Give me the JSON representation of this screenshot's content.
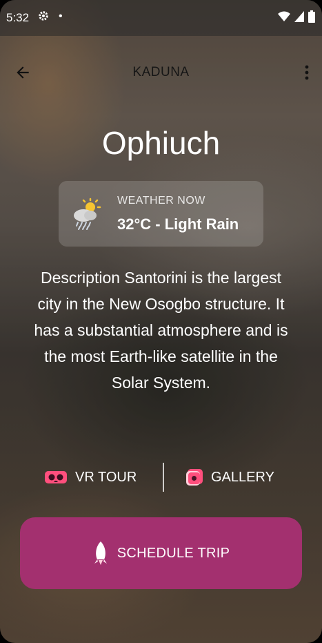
{
  "status_bar": {
    "time": "5:32",
    "icons": [
      "gear-icon",
      "dot-icon",
      "wifi-icon",
      "signal-icon",
      "battery-icon"
    ]
  },
  "app_bar": {
    "title": "KADUNA",
    "back_icon": "arrow-left-icon",
    "more_icon": "more-vert-icon"
  },
  "place": {
    "name": "Ophiuch"
  },
  "weather": {
    "label": "WEATHER NOW",
    "value": "32°C - Light Rain",
    "icon": "sun-cloud-rain-icon"
  },
  "description": "Description Santorini is the largest city in the New Osogbo structure. It has a substantial atmosphere and is the most Earth-like satellite in the Solar System.",
  "actions": {
    "vr_tour": {
      "label": "VR TOUR",
      "icon": "vr-headset-icon"
    },
    "gallery": {
      "label": "GALLERY",
      "icon": "gallery-icon"
    }
  },
  "schedule": {
    "label": "SCHEDULE TRIP",
    "icon": "rocket-icon"
  },
  "colors": {
    "accent": "#a3306f",
    "icon_pink": "#ff4f7d",
    "text": "#ffffff"
  }
}
